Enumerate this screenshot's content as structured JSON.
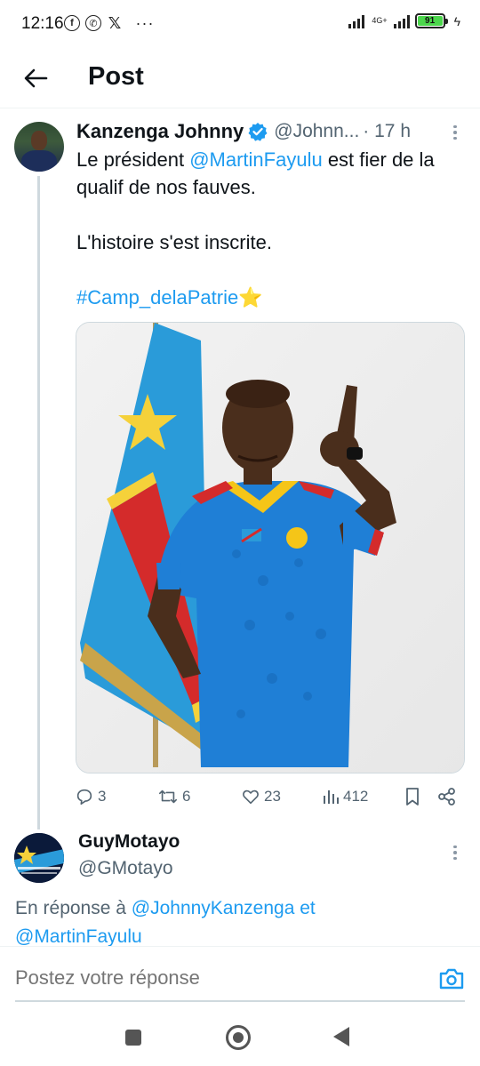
{
  "status_bar": {
    "time": "12:16",
    "notification_icons": [
      "facebook-icon",
      "whatsapp-icon",
      "x-icon"
    ],
    "more": "···",
    "network": "4G+",
    "battery": "91"
  },
  "header": {
    "title": "Post"
  },
  "tweet": {
    "author_name": "Kanzenga Johnny",
    "handle": "@Johnn...",
    "time": "· 17 h",
    "text_line1_prefix": "Le  président ",
    "mention1": "@MartinFayulu",
    "text_line1_suffix": " est fier de la qualif de nos fauves.",
    "text_line2": " L'histoire s'est inscrite.",
    "hashtag": "#Camp_delaPatrie",
    "emoji": "⭐",
    "stats": {
      "replies": "3",
      "reposts": "6",
      "likes": "23",
      "views": "412"
    }
  },
  "reply": {
    "author_name": "GuyMotayo",
    "handle": "@GMotayo",
    "context_prefix": "En réponse à ",
    "mention_a": "@JohnnyKanzenga",
    "context_and": " et",
    "mention_b": "@MartinFayulu"
  },
  "composer": {
    "placeholder": "Postez votre réponse"
  },
  "colors": {
    "link": "#1d9bf0",
    "secondary_text": "#536471",
    "battery": "#4cd64c",
    "jersey": "#1f7fd6"
  }
}
